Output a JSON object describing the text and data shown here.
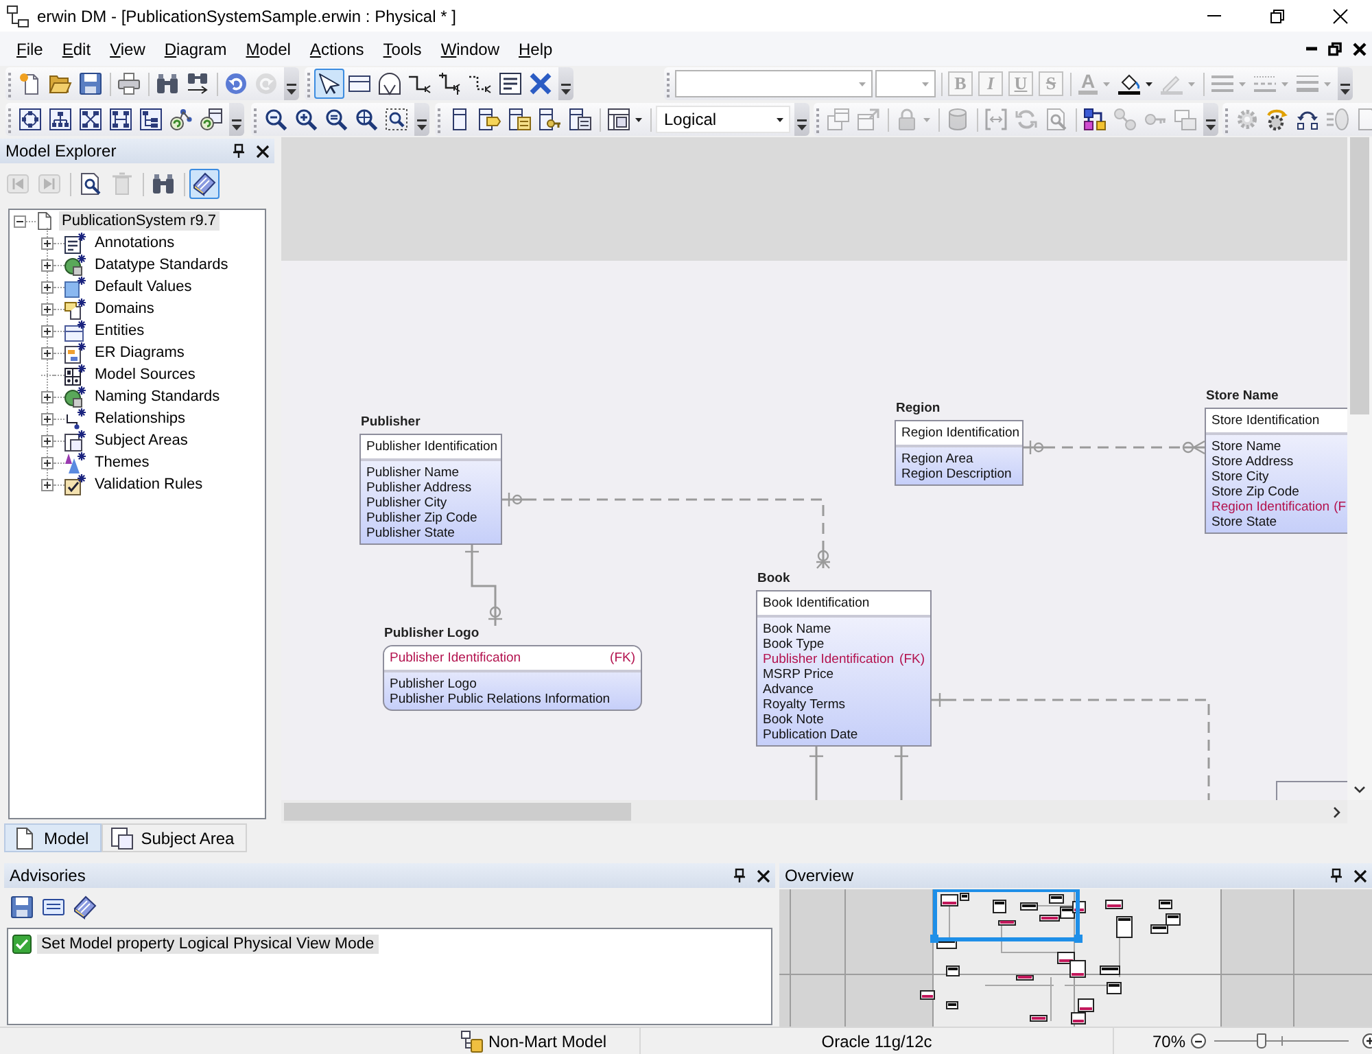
{
  "window": {
    "title": "erwin DM - [PublicationSystemSample.erwin : Physical * ]"
  },
  "menu": [
    {
      "label": "File",
      "mnemonic": true
    },
    {
      "label": "Edit",
      "mnemonic": true
    },
    {
      "label": "View",
      "mnemonic": true
    },
    {
      "label": "Diagram",
      "mnemonic": true
    },
    {
      "label": "Model",
      "mnemonic": true
    },
    {
      "label": "Actions",
      "mnemonic": true
    },
    {
      "label": "Tools",
      "mnemonic": true
    },
    {
      "label": "Window",
      "mnemonic": true
    },
    {
      "label": "Help",
      "mnemonic": true
    }
  ],
  "toolbars": [
    {
      "bands": [
        {
          "items": [
            {
              "kind": "button",
              "disabled": false
            },
            {
              "kind": "button",
              "disabled": false
            },
            {
              "kind": "button",
              "disabled": false
            },
            {
              "kind": "separator"
            },
            {
              "kind": "button",
              "disabled": false
            },
            {
              "kind": "separator"
            },
            {
              "kind": "button",
              "disabled": false
            },
            {
              "kind": "button",
              "disabled": false
            },
            {
              "kind": "separator"
            },
            {
              "kind": "button",
              "disabled": false
            },
            {
              "kind": "button",
              "disabled": true
            }
          ]
        },
        {
          "items": [
            {
              "kind": "button",
              "disabled": false,
              "selected": true
            },
            {
              "kind": "button",
              "disabled": false,
              "selected": false
            },
            {
              "kind": "button",
              "disabled": false,
              "selected": false
            },
            {
              "kind": "button",
              "disabled": false,
              "selected": false
            },
            {
              "kind": "button",
              "disabled": false,
              "selected": false
            },
            {
              "kind": "button",
              "disabled": false,
              "selected": false
            },
            {
              "kind": "button",
              "disabled": false,
              "selected": false
            },
            {
              "kind": "button",
              "disabled": false,
              "selected": false
            }
          ]
        },
        {
          "items": [
            {
              "kind": "combo",
              "disabled": true
            },
            {
              "kind": "combo",
              "disabled": true
            },
            {
              "kind": "separator"
            },
            {
              "kind": "letter",
              "label": "B",
              "disabled": true
            },
            {
              "kind": "letter",
              "label": "I",
              "disabled": true
            },
            {
              "kind": "letter",
              "label": "U",
              "disabled": true
            },
            {
              "kind": "letter",
              "label": "S",
              "disabled": true
            },
            {
              "kind": "separator"
            },
            {
              "kind": "split",
              "label": "A",
              "disabled": true
            },
            {
              "kind": "split",
              "disabled": false
            },
            {
              "kind": "split",
              "disabled": true
            },
            {
              "kind": "separator"
            },
            {
              "kind": "split",
              "disabled": true
            },
            {
              "kind": "split",
              "disabled": true
            },
            {
              "kind": "split",
              "disabled": true
            }
          ]
        }
      ]
    },
    {
      "bands": [
        {
          "items": [
            {
              "kind": "button",
              "disabled": false
            },
            {
              "kind": "button",
              "disabled": false
            },
            {
              "kind": "button",
              "disabled": false
            },
            {
              "kind": "button",
              "disabled": false
            },
            {
              "kind": "button",
              "disabled": false
            },
            {
              "kind": "button",
              "disabled": false
            },
            {
              "kind": "button",
              "disabled": false
            }
          ]
        },
        {
          "items": [
            {
              "kind": "button",
              "disabled": false
            },
            {
              "kind": "button",
              "disabled": false
            },
            {
              "kind": "button",
              "disabled": false
            },
            {
              "kind": "button",
              "disabled": false
            },
            {
              "kind": "button",
              "disabled": false
            }
          ]
        },
        {
          "items": [
            {
              "kind": "button",
              "disabled": false
            },
            {
              "kind": "button",
              "disabled": false
            },
            {
              "kind": "button",
              "disabled": false
            },
            {
              "kind": "button",
              "disabled": false
            },
            {
              "kind": "button",
              "disabled": false
            },
            {
              "kind": "separator"
            },
            {
              "kind": "split",
              "disabled": false
            },
            {
              "kind": "separator"
            },
            {
              "kind": "combo",
              "value": "Logical",
              "disabled": false
            }
          ]
        },
        {
          "items": [
            {
              "kind": "button",
              "disabled": true
            },
            {
              "kind": "button",
              "disabled": true
            },
            {
              "kind": "separator"
            },
            {
              "kind": "split",
              "disabled": true
            },
            {
              "kind": "separator"
            },
            {
              "kind": "button",
              "disabled": true
            },
            {
              "kind": "separator"
            },
            {
              "kind": "button",
              "disabled": true
            },
            {
              "kind": "button",
              "disabled": true
            },
            {
              "kind": "button",
              "disabled": true
            },
            {
              "kind": "separator"
            },
            {
              "kind": "button",
              "disabled": false
            },
            {
              "kind": "button",
              "disabled": true
            },
            {
              "kind": "button",
              "disabled": true
            },
            {
              "kind": "button",
              "disabled": true
            }
          ]
        },
        {
          "items": [
            {
              "kind": "button",
              "disabled": true
            },
            {
              "kind": "button",
              "disabled": false
            },
            {
              "kind": "button",
              "disabled": false
            },
            {
              "kind": "button",
              "disabled": true
            },
            {
              "kind": "button",
              "disabled": true
            }
          ]
        }
      ]
    }
  ],
  "model_explorer": {
    "title": "Model Explorer",
    "toolbar": [
      {
        "kind": "button",
        "disabled": true,
        "selected": false
      },
      {
        "kind": "button",
        "disabled": true,
        "selected": false
      },
      {
        "kind": "separator"
      },
      {
        "kind": "button",
        "disabled": false,
        "selected": false
      },
      {
        "kind": "button",
        "disabled": true,
        "selected": false
      },
      {
        "kind": "separator"
      },
      {
        "kind": "button",
        "disabled": false,
        "selected": false
      },
      {
        "kind": "separator"
      },
      {
        "kind": "button",
        "disabled": false,
        "selected": true
      }
    ],
    "tree": [
      {
        "label": "PublicationSystem r9.7",
        "expandable": true,
        "expanded": true,
        "selected": true,
        "children": [
          {
            "label": "Annotations",
            "expandable": true,
            "expanded": false,
            "selected": false
          },
          {
            "label": "Datatype Standards",
            "expandable": true,
            "expanded": false,
            "selected": false
          },
          {
            "label": "Default Values",
            "expandable": true,
            "expanded": false,
            "selected": false
          },
          {
            "label": "Domains",
            "expandable": true,
            "expanded": false,
            "selected": false
          },
          {
            "label": "Entities",
            "expandable": true,
            "expanded": false,
            "selected": false
          },
          {
            "label": "ER Diagrams",
            "expandable": true,
            "expanded": false,
            "selected": false
          },
          {
            "label": "Model Sources",
            "expandable": false,
            "selected": false
          },
          {
            "label": "Naming Standards",
            "expandable": true,
            "expanded": false,
            "selected": false
          },
          {
            "label": "Relationships",
            "expandable": true,
            "expanded": false,
            "selected": false
          },
          {
            "label": "Subject Areas",
            "expandable": true,
            "expanded": false,
            "selected": false
          },
          {
            "label": "Themes",
            "expandable": true,
            "expanded": false,
            "selected": false
          },
          {
            "label": "Validation Rules",
            "expandable": true,
            "expanded": false,
            "selected": false
          }
        ]
      }
    ],
    "tabs": [
      {
        "label": "Model",
        "selected": true
      },
      {
        "label": "Subject Area",
        "selected": false
      }
    ]
  },
  "diagram": {
    "entities": [
      {
        "name": "Publisher",
        "kind": "independent",
        "key": [
          {
            "name": "Publisher Identification",
            "foreign": false
          }
        ],
        "attributes": [
          {
            "name": "Publisher Name",
            "foreign": false
          },
          {
            "name": "Publisher Address",
            "foreign": false
          },
          {
            "name": "Publisher City",
            "foreign": false
          },
          {
            "name": "Publisher Zip Code",
            "foreign": false
          },
          {
            "name": "Publisher State",
            "foreign": false
          }
        ]
      },
      {
        "name": "Region",
        "kind": "independent",
        "key": [
          {
            "name": "Region Identification",
            "foreign": false
          }
        ],
        "attributes": [
          {
            "name": "Region Area",
            "foreign": false
          },
          {
            "name": "Region Description",
            "foreign": false
          }
        ]
      },
      {
        "name": "Store Name",
        "kind": "independent",
        "key": [
          {
            "name": "Store Identification",
            "foreign": false
          }
        ],
        "attributes": [
          {
            "name": "Store Name",
            "foreign": false
          },
          {
            "name": "Store Address",
            "foreign": false
          },
          {
            "name": "Store City",
            "foreign": false
          },
          {
            "name": "Store Zip Code",
            "foreign": false
          },
          {
            "name": "Region Identification",
            "note": "(F",
            "foreign": true
          },
          {
            "name": "Store State",
            "foreign": false
          }
        ]
      },
      {
        "name": "Book",
        "kind": "independent",
        "key": [
          {
            "name": "Book Identification",
            "foreign": false
          }
        ],
        "attributes": [
          {
            "name": "Book Name",
            "foreign": false
          },
          {
            "name": "Book Type",
            "foreign": false
          },
          {
            "name": "Publisher Identification",
            "note": "(FK)",
            "foreign": true
          },
          {
            "name": "MSRP Price",
            "foreign": false
          },
          {
            "name": "Advance",
            "foreign": false
          },
          {
            "name": "Royalty Terms",
            "foreign": false
          },
          {
            "name": "Book Note",
            "foreign": false
          },
          {
            "name": "Publication Date",
            "foreign": false
          }
        ]
      },
      {
        "name": "Publisher Logo",
        "kind": "dependent",
        "key": [
          {
            "name": "Publisher Identification",
            "note": "(FK)",
            "foreign": true
          }
        ],
        "attributes": [
          {
            "name": "Publisher Logo",
            "foreign": false
          },
          {
            "name": "Publisher Public Relations Information",
            "foreign": false
          }
        ]
      }
    ]
  },
  "advisories": {
    "title": "Advisories",
    "toolbar": [
      {
        "kind": "button",
        "disabled": false
      },
      {
        "kind": "button",
        "disabled": false
      },
      {
        "kind": "button",
        "disabled": false
      }
    ],
    "messages": [
      {
        "text": "Set Model property Logical Physical View Mode",
        "selected": true
      }
    ]
  },
  "overview": {
    "title": "Overview"
  },
  "status_bar": {
    "model_type": "Non-Mart Model",
    "database": "Oracle 11g/12c",
    "zoom": {
      "reading": "70%",
      "level": 0.35
    }
  }
}
